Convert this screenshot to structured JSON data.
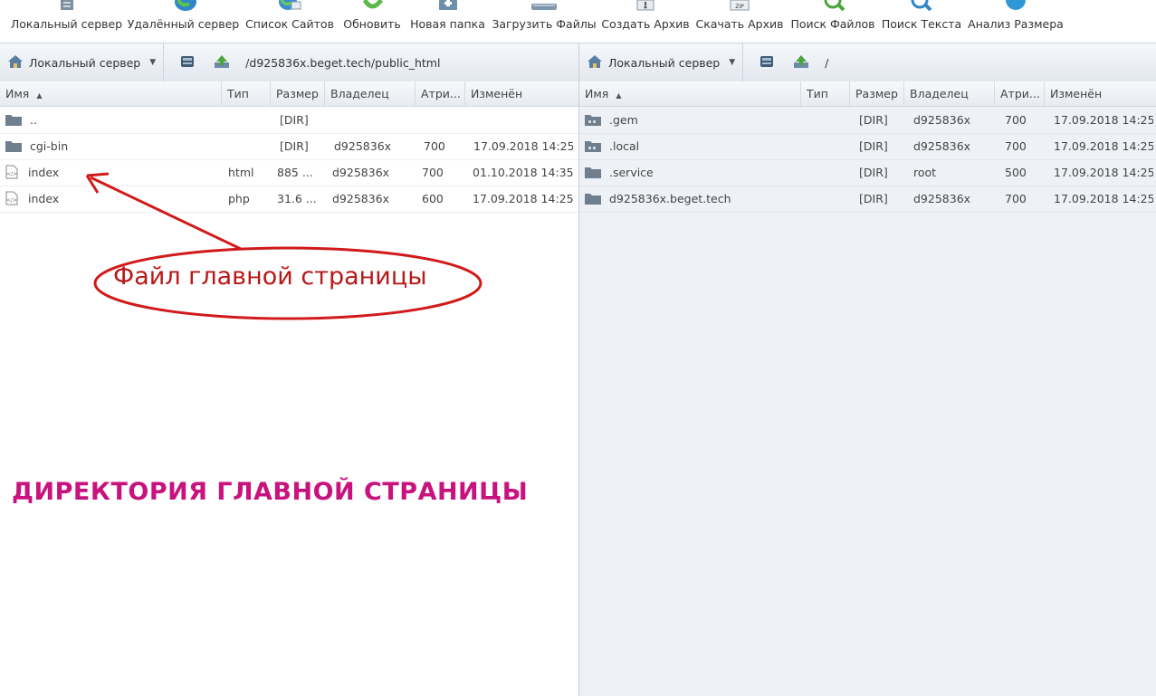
{
  "toolbar": {
    "items": [
      {
        "label": "Локальный сервер",
        "icon": "local-server-icon"
      },
      {
        "label": "Удалённый сервер",
        "icon": "remote-server-icon"
      },
      {
        "label": "Список Сайтов",
        "icon": "site-list-icon"
      },
      {
        "label": "Обновить",
        "icon": "refresh-icon"
      },
      {
        "label": "Новая папка",
        "icon": "new-folder-icon"
      },
      {
        "label": "Загрузить Файлы",
        "icon": "upload-icon"
      },
      {
        "label": "Создать Архив",
        "icon": "create-archive-icon"
      },
      {
        "label": "Скачать Архив",
        "icon": "zip-icon"
      },
      {
        "label": "Поиск Файлов",
        "icon": "file-search-icon"
      },
      {
        "label": "Поиск Текста",
        "icon": "text-search-icon"
      },
      {
        "label": "Анализ Размера",
        "icon": "size-analysis-icon"
      }
    ]
  },
  "left_panel": {
    "server": "Локальный сервер",
    "path": "/d925836x.beget.tech/public_html",
    "columns": [
      "Имя",
      "Тип",
      "Размер",
      "Владелец",
      "Атри...",
      "Изменён"
    ],
    "rows": [
      {
        "name": "..",
        "type": "",
        "size": "[DIR]",
        "owner": "",
        "attr": "",
        "modified": "",
        "kind": "folder"
      },
      {
        "name": "cgi-bin",
        "type": "",
        "size": "[DIR]",
        "owner": "d925836x",
        "attr": "700",
        "modified": "17.09.2018 14:25...",
        "kind": "folder"
      },
      {
        "name": "index",
        "type": "html",
        "size": "885 ...",
        "owner": "d925836x",
        "attr": "700",
        "modified": "01.10.2018 14:35...",
        "kind": "file"
      },
      {
        "name": "index",
        "type": "php",
        "size": "31.6 ...",
        "owner": "d925836x",
        "attr": "600",
        "modified": "17.09.2018 14:25...",
        "kind": "file"
      }
    ]
  },
  "right_panel": {
    "server": "Локальный сервер",
    "path": "/",
    "columns": [
      "Имя",
      "Тип",
      "Размер",
      "Владелец",
      "Атри...",
      "Изменён"
    ],
    "rows": [
      {
        "name": ".gem",
        "type": "",
        "size": "[DIR]",
        "owner": "d925836x",
        "attr": "700",
        "modified": "17.09.2018 14:25...",
        "kind": "folder-dots"
      },
      {
        "name": ".local",
        "type": "",
        "size": "[DIR]",
        "owner": "d925836x",
        "attr": "700",
        "modified": "17.09.2018 14:25...",
        "kind": "folder-dots"
      },
      {
        "name": ".service",
        "type": "",
        "size": "[DIR]",
        "owner": "root",
        "attr": "500",
        "modified": "17.09.2018 14:25...",
        "kind": "folder"
      },
      {
        "name": "d925836x.beget.tech",
        "type": "",
        "size": "[DIR]",
        "owner": "d925836x",
        "attr": "700",
        "modified": "17.09.2018 14:25...",
        "kind": "folder"
      }
    ]
  },
  "annotations": {
    "file_label": "Файл главной страницы",
    "dir_label": "ДИРЕКТОРИЯ ГЛАВНОЙ СТРАНИЦЫ",
    "color_red": "#b91818",
    "color_magenta": "#c8137e"
  }
}
